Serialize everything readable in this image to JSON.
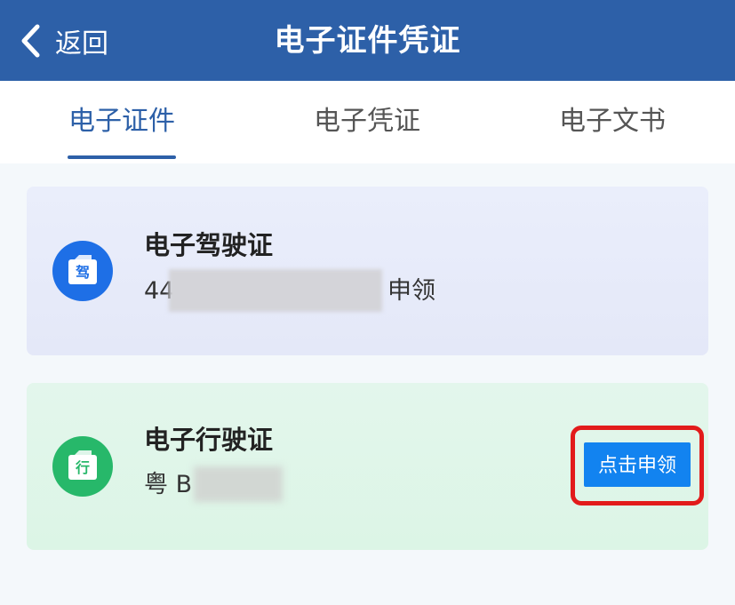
{
  "header": {
    "back_label": "返回",
    "title": "电子证件凭证"
  },
  "tabs": [
    {
      "label": "电子证件",
      "active": true
    },
    {
      "label": "电子凭证",
      "active": false
    },
    {
      "label": "电子文书",
      "active": false
    }
  ],
  "cards": [
    {
      "title": "电子驾驶证",
      "icon": "driver-license-icon",
      "icon_char": "驾",
      "icon_color": "#1e6fe6",
      "id_prefix": "44",
      "status": "申领"
    },
    {
      "title": "电子行驶证",
      "icon": "vehicle-license-icon",
      "icon_char": "行",
      "icon_color": "#27b86a",
      "plate_prefix": "粤 B",
      "button_label": "点击申领"
    }
  ],
  "colors": {
    "header_bg": "#2d60a8",
    "accent": "#2d60a8",
    "button": "#1283f0",
    "highlight": "#e21b1b"
  }
}
